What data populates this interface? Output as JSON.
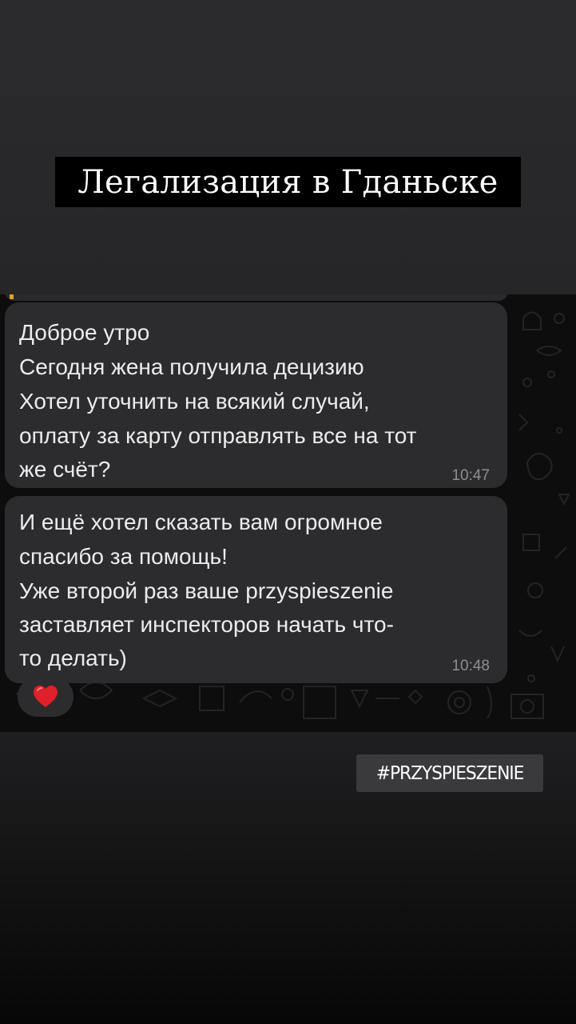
{
  "story": {
    "title": "Легализация в Гданьске",
    "hashtag": "#PRZYSPIESZENIE"
  },
  "chat": {
    "messages": [
      {
        "lines": [
          "Доброе утро",
          "Сегодня жена получила децизию",
          "Хотел уточнить на всякий случай,",
          "оплату за карту отправлять все на тот",
          "же счёт?"
        ],
        "time": "10:47"
      },
      {
        "lines": [
          "И ещё хотел сказать вам огромное",
          "спасибо за помощь!",
          "Уже второй раз ваше przyspieszenie",
          "заставляет инспекторов начать что-",
          "то делать)"
        ],
        "time": "10:48"
      }
    ],
    "reaction": {
      "icon": "heart-icon",
      "color": "#e0202a"
    }
  },
  "colors": {
    "bubble": "#2c2c2e",
    "chat_background": "#0d0d0d",
    "title_background": "#000000",
    "hashtag_background": "#3a3a3c"
  }
}
